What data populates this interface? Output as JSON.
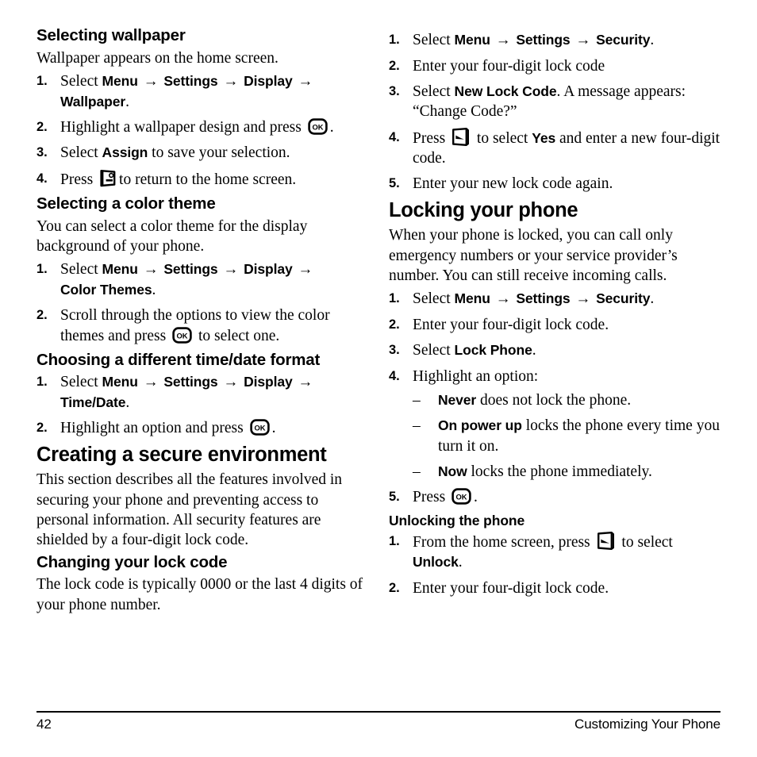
{
  "page": {
    "number": "42",
    "footer_title": "Customizing Your Phone"
  },
  "icons": {
    "ok_key": "ok-key-icon",
    "ok_key_label": "OK",
    "end_key": "end-call-key-icon",
    "softkey": "left-softkey-icon"
  },
  "left_column": {
    "sections": [
      {
        "heading": "Selecting wallpaper",
        "intro": "Wallpaper appears on the home screen.",
        "steps": [
          {
            "num": "1.",
            "parts": [
              {
                "t": "text",
                "v": "Select "
              },
              {
                "t": "ui",
                "v": "Menu"
              },
              {
                "t": "arrow"
              },
              {
                "t": "ui",
                "v": "Settings"
              },
              {
                "t": "arrow"
              },
              {
                "t": "ui",
                "v": "Display"
              },
              {
                "t": "arrow"
              },
              {
                "t": "break"
              },
              {
                "t": "ui",
                "v": "Wallpaper"
              },
              {
                "t": "text",
                "v": "."
              }
            ]
          },
          {
            "num": "2.",
            "parts": [
              {
                "t": "text",
                "v": "Highlight a wallpaper design and press "
              },
              {
                "t": "icon",
                "v": "ok"
              },
              {
                "t": "text",
                "v": "."
              }
            ]
          },
          {
            "num": "3.",
            "parts": [
              {
                "t": "text",
                "v": "Select "
              },
              {
                "t": "ui",
                "v": "Assign"
              },
              {
                "t": "text",
                "v": " to save your selection."
              }
            ]
          },
          {
            "num": "4.",
            "parts": [
              {
                "t": "text",
                "v": "Press "
              },
              {
                "t": "icon",
                "v": "end"
              },
              {
                "t": "text",
                "v": "to return to the home screen."
              }
            ]
          }
        ]
      },
      {
        "heading": "Selecting a color theme",
        "intro": "You can select a color theme for the display background of your phone.",
        "steps": [
          {
            "num": "1.",
            "parts": [
              {
                "t": "text",
                "v": "Select "
              },
              {
                "t": "ui",
                "v": "Menu"
              },
              {
                "t": "arrow"
              },
              {
                "t": "ui",
                "v": "Settings"
              },
              {
                "t": "arrow"
              },
              {
                "t": "ui",
                "v": "Display"
              },
              {
                "t": "arrow"
              },
              {
                "t": "break"
              },
              {
                "t": "ui",
                "v": "Color Themes"
              },
              {
                "t": "text",
                "v": "."
              }
            ]
          },
          {
            "num": "2.",
            "parts": [
              {
                "t": "text",
                "v": "Scroll through the options to view the color themes and press "
              },
              {
                "t": "icon",
                "v": "ok"
              },
              {
                "t": "text",
                "v": " to select one."
              }
            ]
          }
        ]
      },
      {
        "heading": "Choosing a different time/date format",
        "intro": "",
        "steps": [
          {
            "num": "1.",
            "parts": [
              {
                "t": "text",
                "v": "Select "
              },
              {
                "t": "ui",
                "v": "Menu"
              },
              {
                "t": "arrow"
              },
              {
                "t": "ui",
                "v": "Settings"
              },
              {
                "t": "arrow"
              },
              {
                "t": "ui",
                "v": "Display"
              },
              {
                "t": "arrow"
              },
              {
                "t": "break"
              },
              {
                "t": "ui",
                "v": "Time/Date"
              },
              {
                "t": "text",
                "v": "."
              }
            ]
          },
          {
            "num": "2.",
            "parts": [
              {
                "t": "text",
                "v": "Highlight an option and press "
              },
              {
                "t": "icon",
                "v": "ok"
              },
              {
                "t": "text",
                "v": "."
              }
            ]
          }
        ]
      },
      {
        "heading": "Creating a secure environment",
        "level": "major",
        "intro": "This section describes all the features involved in securing your phone and preventing access to personal information. All security features are shielded by a four-digit lock code.",
        "steps": []
      },
      {
        "heading": "Changing your lock code",
        "intro": "The lock code is typically 0000 or the last 4 digits of your phone number.",
        "steps": []
      }
    ]
  },
  "right_column": {
    "sections": [
      {
        "heading": "",
        "intro": "",
        "steps": [
          {
            "num": "1.",
            "parts": [
              {
                "t": "text",
                "v": "Select "
              },
              {
                "t": "ui",
                "v": "Menu"
              },
              {
                "t": "arrow"
              },
              {
                "t": "ui",
                "v": "Settings"
              },
              {
                "t": "arrow"
              },
              {
                "t": "ui",
                "v": "Security"
              },
              {
                "t": "text",
                "v": "."
              }
            ]
          },
          {
            "num": "2.",
            "parts": [
              {
                "t": "text",
                "v": "Enter your four-digit lock code"
              }
            ]
          },
          {
            "num": "3.",
            "parts": [
              {
                "t": "text",
                "v": "Select "
              },
              {
                "t": "ui",
                "v": "New Lock Code"
              },
              {
                "t": "text",
                "v": ". A message appears: “Change Code?”"
              }
            ]
          },
          {
            "num": "4.",
            "parts": [
              {
                "t": "text",
                "v": "Press "
              },
              {
                "t": "icon",
                "v": "softkey"
              },
              {
                "t": "text",
                "v": " to select "
              },
              {
                "t": "ui",
                "v": "Yes"
              },
              {
                "t": "text",
                "v": " and enter a new four-digit code."
              }
            ]
          },
          {
            "num": "5.",
            "parts": [
              {
                "t": "text",
                "v": "Enter your new lock code again."
              }
            ]
          }
        ]
      },
      {
        "heading": "Locking your phone",
        "level": "major",
        "intro": "When your phone is locked, you can call only emergency numbers or your service provider’s number. You can still receive incoming calls.",
        "steps": [
          {
            "num": "1.",
            "parts": [
              {
                "t": "text",
                "v": "Select "
              },
              {
                "t": "ui",
                "v": "Menu"
              },
              {
                "t": "arrow"
              },
              {
                "t": "ui",
                "v": "Settings"
              },
              {
                "t": "arrow"
              },
              {
                "t": "ui",
                "v": "Security"
              },
              {
                "t": "text",
                "v": "."
              }
            ]
          },
          {
            "num": "2.",
            "parts": [
              {
                "t": "text",
                "v": "Enter your four-digit lock code."
              }
            ]
          },
          {
            "num": "3.",
            "parts": [
              {
                "t": "text",
                "v": "Select "
              },
              {
                "t": "ui",
                "v": "Lock Phone"
              },
              {
                "t": "text",
                "v": "."
              }
            ]
          },
          {
            "num": "4.",
            "parts": [
              {
                "t": "text",
                "v": "Highlight an option:"
              }
            ],
            "dashes": [
              [
                {
                  "t": "ui",
                  "v": "Never"
                },
                {
                  "t": "text",
                  "v": " does not lock the phone."
                }
              ],
              [
                {
                  "t": "ui",
                  "v": "On power up"
                },
                {
                  "t": "text",
                  "v": " locks the phone every time you turn it on."
                }
              ],
              [
                {
                  "t": "ui",
                  "v": "Now"
                },
                {
                  "t": "text",
                  "v": " locks the phone immediately."
                }
              ]
            ]
          },
          {
            "num": "5.",
            "parts": [
              {
                "t": "text",
                "v": "Press "
              },
              {
                "t": "icon",
                "v": "ok"
              },
              {
                "t": "text",
                "v": "."
              }
            ]
          }
        ]
      },
      {
        "heading": "Unlocking the phone",
        "level": "sub",
        "intro": "",
        "steps": [
          {
            "num": "1.",
            "parts": [
              {
                "t": "text",
                "v": "From the home screen, press "
              },
              {
                "t": "icon",
                "v": "softkey"
              },
              {
                "t": "text",
                "v": " to select "
              },
              {
                "t": "ui",
                "v": "Unlock"
              },
              {
                "t": "text",
                "v": "."
              }
            ]
          },
          {
            "num": "2.",
            "parts": [
              {
                "t": "text",
                "v": "Enter your four-digit lock code."
              }
            ]
          }
        ]
      }
    ]
  }
}
